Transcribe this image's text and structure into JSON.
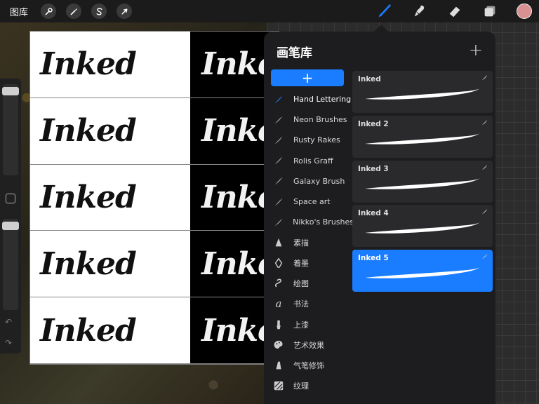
{
  "topbar": {
    "gallery_label": "图库",
    "left_tools": [
      "wrench-icon",
      "magic-wand-icon",
      "selection-s-icon",
      "arrow-cursor-icon"
    ],
    "right_tools": [
      "brush-icon",
      "smudge-icon",
      "eraser-icon",
      "layers-icon"
    ],
    "active_tool": "brush-icon",
    "color": "#d99090"
  },
  "artwork": {
    "rows": [
      {
        "left": "Inked",
        "right": "Inked"
      },
      {
        "left": "Inked",
        "right": "Inked"
      },
      {
        "left": "Inked",
        "right": "Inked"
      },
      {
        "left": "Inked",
        "right": "Inked"
      },
      {
        "left": "Inked",
        "right": "Inked"
      }
    ]
  },
  "panel": {
    "title": "画笔库",
    "add_label": "+",
    "new_set_label": "+",
    "accent": "#1a7cff",
    "sets": [
      {
        "label": "Hand Lettering",
        "icon": "brush-stroke-icon",
        "active": true
      },
      {
        "label": "Neon Brushes",
        "icon": "brush-stroke-icon"
      },
      {
        "label": "Rusty Rakes",
        "icon": "brush-stroke-icon"
      },
      {
        "label": "Rolis Graff",
        "icon": "brush-stroke-icon"
      },
      {
        "label": "Galaxy Brush",
        "icon": "brush-stroke-icon"
      },
      {
        "label": "Space art",
        "icon": "brush-stroke-icon"
      },
      {
        "label": "Nikko's Brushes",
        "icon": "brush-stroke-icon"
      },
      {
        "label": "素描",
        "icon": "pencil-tip-icon"
      },
      {
        "label": "着墨",
        "icon": "ink-pen-icon"
      },
      {
        "label": "绘图",
        "icon": "squiggle-icon"
      },
      {
        "label": "书法",
        "icon": "calligraphy-a-icon"
      },
      {
        "label": "上漆",
        "icon": "paint-brush-icon"
      },
      {
        "label": "艺术效果",
        "icon": "palette-icon"
      },
      {
        "label": "气笔修饰",
        "icon": "airbrush-icon"
      },
      {
        "label": "纹理",
        "icon": "texture-icon"
      }
    ],
    "brushes": [
      {
        "name": "Inked",
        "selected": false
      },
      {
        "name": "Inked 2",
        "selected": false
      },
      {
        "name": "Inked 3",
        "selected": false
      },
      {
        "name": "Inked 4",
        "selected": false
      },
      {
        "name": "Inked 5",
        "selected": true
      }
    ]
  }
}
